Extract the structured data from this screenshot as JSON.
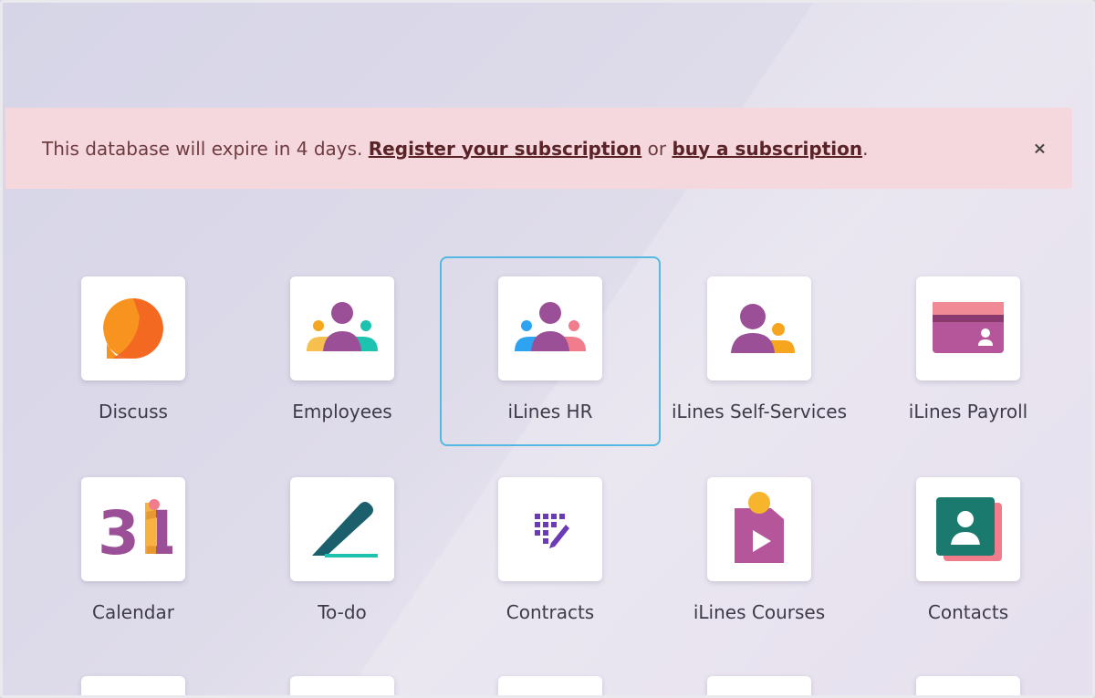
{
  "banner": {
    "text_before": "This database will expire in 4 days.",
    "link_register": "Register your subscription",
    "text_middle": "or",
    "link_buy": "buy a subscription",
    "text_after": ".",
    "close_glyph": "×"
  },
  "apps": [
    {
      "label": "Discuss",
      "icon": "discuss-icon"
    },
    {
      "label": "Employees",
      "icon": "employees-icon"
    },
    {
      "label": "iLines HR",
      "icon": "hr-people-icon"
    },
    {
      "label": "iLines Self-Services",
      "icon": "self-services-icon"
    },
    {
      "label": "iLines Payroll",
      "icon": "payroll-card-icon"
    },
    {
      "label": "Calendar",
      "icon": "calendar-icon"
    },
    {
      "label": "To-do",
      "icon": "todo-pen-icon"
    },
    {
      "label": "Contracts",
      "icon": "contracts-icon"
    },
    {
      "label": "iLines Courses",
      "icon": "courses-icon"
    },
    {
      "label": "Contacts",
      "icon": "contacts-icon"
    }
  ],
  "calendar_day": "31",
  "colors": {
    "banner_bg": "#f5d8dd",
    "selection": "#54b8e0",
    "purple": "#9b4f96",
    "orange": "#f6a51e",
    "teal": "#1ec3b0"
  }
}
